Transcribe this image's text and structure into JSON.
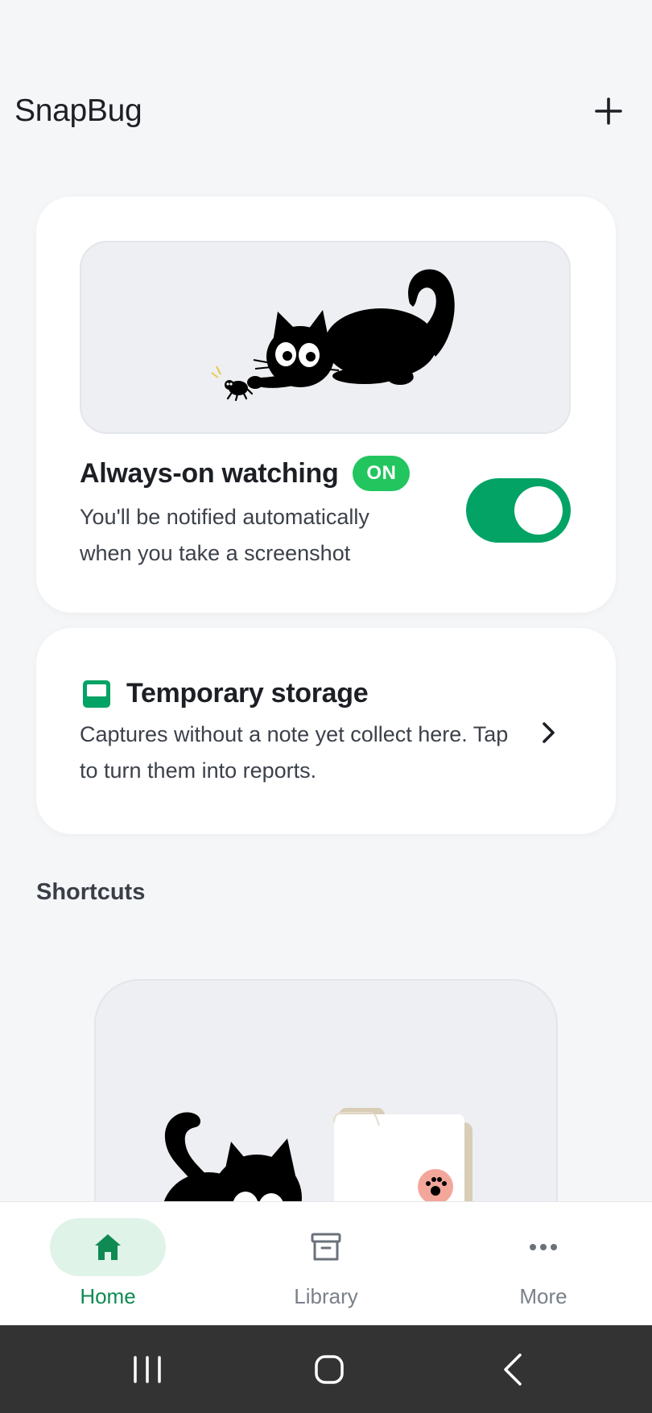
{
  "header": {
    "title": "SnapBug"
  },
  "watch_card": {
    "title": "Always-on watching",
    "badge": "ON",
    "description": "You'll be notified automatically when you take a screenshot",
    "toggle_on": true
  },
  "storage_card": {
    "title": "Temporary storage",
    "description": "Captures without a note yet collect here. Tap to turn them into reports."
  },
  "shortcuts": {
    "title": "Shortcuts"
  },
  "bottom_nav": {
    "items": [
      {
        "label": "Home",
        "icon": "home-icon",
        "active": true
      },
      {
        "label": "Library",
        "icon": "archive-box-icon",
        "active": false
      },
      {
        "label": "More",
        "icon": "more-dots-icon",
        "active": false
      }
    ]
  },
  "colors": {
    "accent": "#03a365",
    "badge": "#22c55e",
    "nav_active_text": "#0f8a52",
    "nav_active_pill": "#dff3e8",
    "background": "#f5f6f8"
  }
}
